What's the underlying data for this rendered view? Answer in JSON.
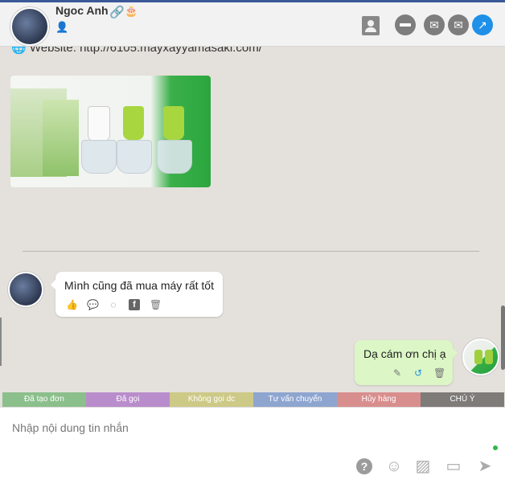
{
  "header": {
    "contact_name": "Ngoc Anh"
  },
  "chat": {
    "website_text": "🌐 Website: http://6105.mayxayyamasaki.com/",
    "incoming_message": "Mình cũng đã mua máy rất tốt",
    "outgoing_message": "Dạ cám ơn chị ạ"
  },
  "tags": [
    {
      "label": "Đã tạo đơn",
      "color": "#8bbf8b"
    },
    {
      "label": "Đã gọi",
      "color": "#b98ccb"
    },
    {
      "label": "Không gọi dc",
      "color": "#cdc986"
    },
    {
      "label": "Tư vấn chuyển",
      "color": "#8ea5d0"
    },
    {
      "label": "Hủy hàng",
      "color": "#d98e8e"
    },
    {
      "label": "CHÚ Ý",
      "color": "#7e7b79"
    }
  ],
  "composer": {
    "placeholder": "Nhập nội dung tin nhắn"
  }
}
